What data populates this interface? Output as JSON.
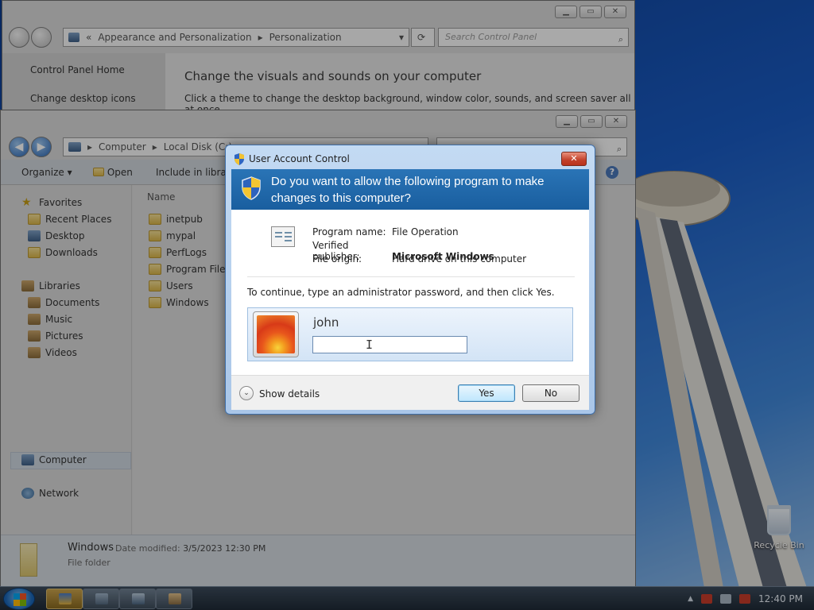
{
  "control_panel": {
    "breadcrumb": [
      "Appearance and Personalization",
      "Personalization"
    ],
    "search_placeholder": "Search Control Panel",
    "links": [
      "Control Panel Home",
      "Change desktop icons"
    ],
    "heading": "Change the visuals and sounds on your computer",
    "subtext": "Click a theme to change the desktop background, window color, sounds, and screen saver all at once."
  },
  "explorer": {
    "breadcrumb": [
      "Computer",
      "Local Disk (C:)"
    ],
    "toolbar": [
      "Organize",
      "Open",
      "Include in library"
    ],
    "nav": {
      "favorites": "Favorites",
      "favorites_items": [
        "Recent Places",
        "Desktop",
        "Downloads"
      ],
      "libraries": "Libraries",
      "libraries_items": [
        "Documents",
        "Music",
        "Pictures",
        "Videos"
      ],
      "computer": "Computer",
      "network": "Network"
    },
    "column_header": "Name",
    "files": [
      "inetpub",
      "mypal",
      "PerfLogs",
      "Program Files",
      "Users",
      "Windows"
    ],
    "details": {
      "name": "Windows",
      "date_label": "Date modified:",
      "date_value": "3/5/2023 12:30 PM",
      "kind": "File folder"
    }
  },
  "uac": {
    "title": "User Account Control",
    "question": "Do you want to allow the following program to make changes to this computer?",
    "program_name_label": "Program name:",
    "program_name": "File Operation",
    "publisher_label": "Verified publisher:",
    "publisher": "Microsoft Windows",
    "origin_label": "File origin:",
    "origin": "Hard drive on this computer",
    "instruction": "To continue, type an administrator password, and then click Yes.",
    "username": "john",
    "password_value": "",
    "show_details": "Show details",
    "yes": "Yes",
    "no": "No"
  },
  "desktop": {
    "recycle_bin": "Recycle Bin"
  },
  "taskbar": {
    "clock": "12:40 PM"
  },
  "colors": {
    "uac_banner": "#195e9f",
    "uac_frame": "#a9c6e8",
    "close_button": "#c2402a",
    "default_button": "#bee6fd"
  }
}
